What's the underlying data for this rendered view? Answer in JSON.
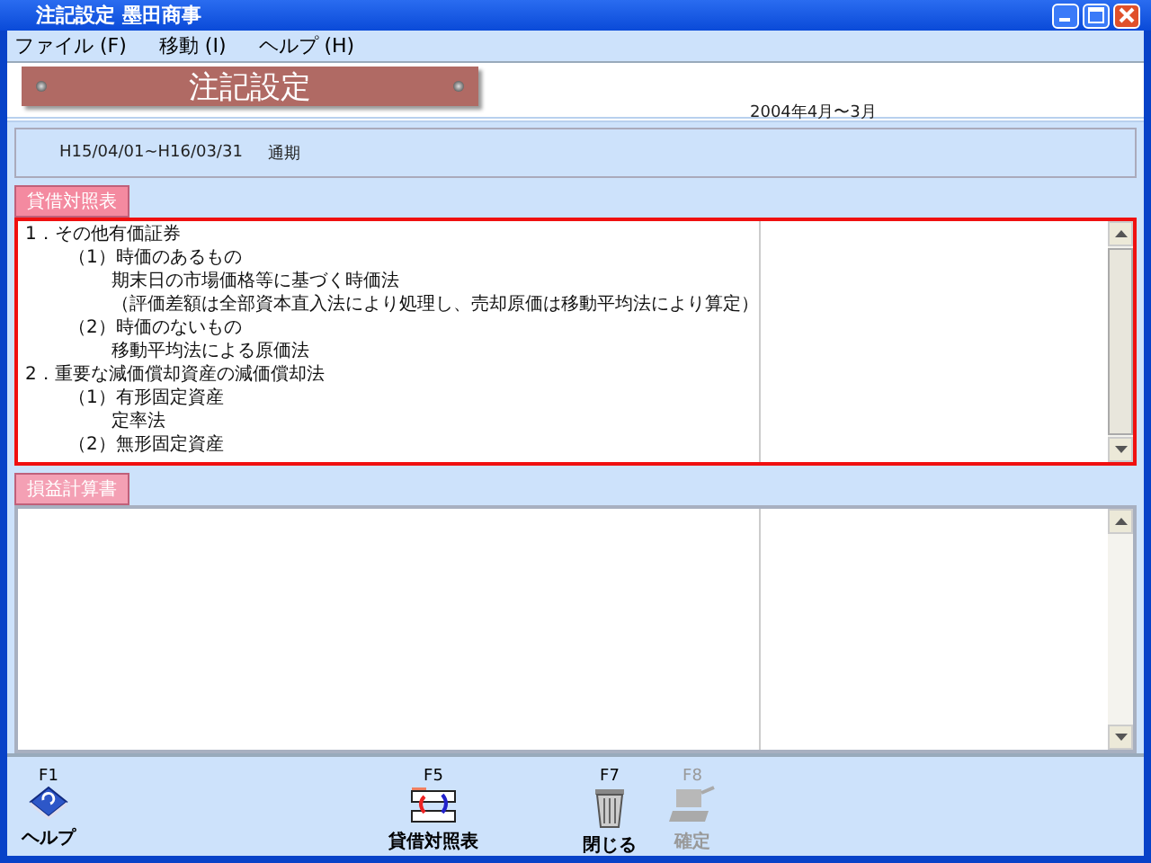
{
  "window": {
    "title": "注記設定 墨田商事"
  },
  "menu": [
    {
      "label": "ファイル (F)"
    },
    {
      "label": "移動 (I)"
    },
    {
      "label": "ヘルプ (H)"
    }
  ],
  "banner": {
    "title": "注記設定",
    "fiscal_year": "2004年4月〜3月"
  },
  "period": {
    "range": "H15/04/01~H16/03/31",
    "type": "通期"
  },
  "sections": [
    {
      "label": "貸借対照表",
      "selected": true,
      "items": [
        {
          "text": "1．その他有価証券",
          "children": [
            {
              "text": "（1）時価のあるもの",
              "children": [
                {
                  "text": "期末日の市場価格等に基づく時価法"
                },
                {
                  "text": "（評価差額は全部資本直入法により処理し、売却原価は移動平均法により算定）"
                }
              ]
            },
            {
              "text": "（2）時価のないもの",
              "children": [
                {
                  "text": "移動平均法による原価法"
                }
              ]
            }
          ]
        },
        {
          "text": "2．重要な減価償却資産の減価償却法",
          "children": [
            {
              "text": "（1）有形固定資産",
              "children": [
                {
                  "text": "定率法"
                }
              ]
            },
            {
              "text": "（2）無形固定資産"
            }
          ]
        }
      ]
    },
    {
      "label": "損益計算書",
      "selected": false
    }
  ],
  "function_keys": [
    {
      "key": "F1",
      "label": "ヘルプ",
      "kind": "help",
      "disabled": false
    },
    {
      "key": "F5",
      "label": "貸借対照表",
      "kind": "switch",
      "disabled": false
    },
    {
      "key": "F7",
      "label": "閉じる",
      "kind": "trash",
      "disabled": false
    },
    {
      "key": "F8",
      "label": "確定",
      "kind": "confirm",
      "disabled": true
    }
  ]
}
